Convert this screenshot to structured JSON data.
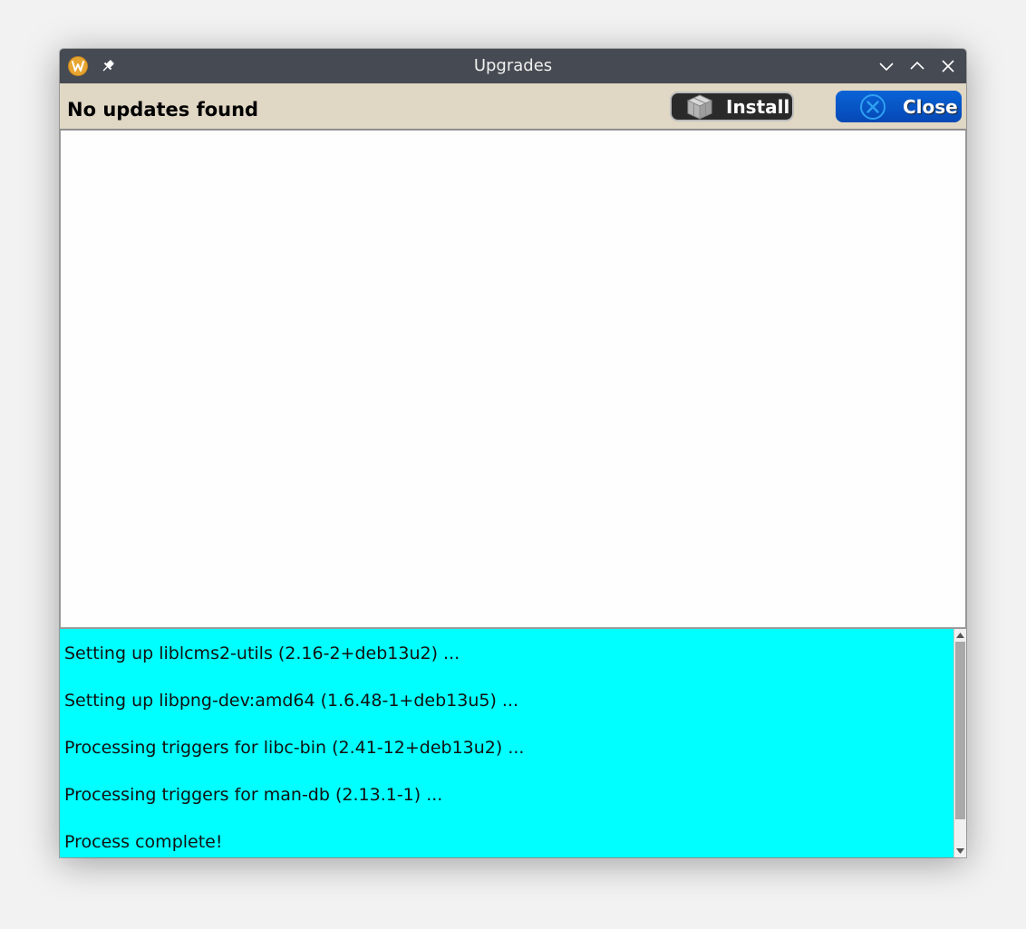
{
  "window": {
    "title": "Upgrades"
  },
  "toolbar": {
    "status": "No updates found",
    "install_label": "Install",
    "close_label": "Close"
  },
  "log": {
    "lines": [
      "Setting up liblcms2-utils (2.16-2+deb13u2) ...",
      "Setting up libpng-dev:amd64 (1.6.48-1+deb13u5) ...",
      "Processing triggers for libc-bin (2.41-12+deb13u2) ...",
      "Processing triggers for man-db (2.13.1-1) ...",
      "Process complete!"
    ],
    "background_color": "#00ffff"
  },
  "icons": {
    "app": "app-logo-icon",
    "pin": "pin-icon",
    "minimize": "minimize-icon",
    "maximize": "maximize-icon",
    "close_window": "close-icon",
    "install": "package-box-icon",
    "close_button": "circle-x-icon",
    "scroll_up": "scroll-up-icon",
    "scroll_down": "scroll-down-icon"
  },
  "colors": {
    "titlebar": "#464a52",
    "toolbar": "#e0d7c4",
    "close_button": "#0548b5",
    "install_button": "#2a2a2a"
  }
}
